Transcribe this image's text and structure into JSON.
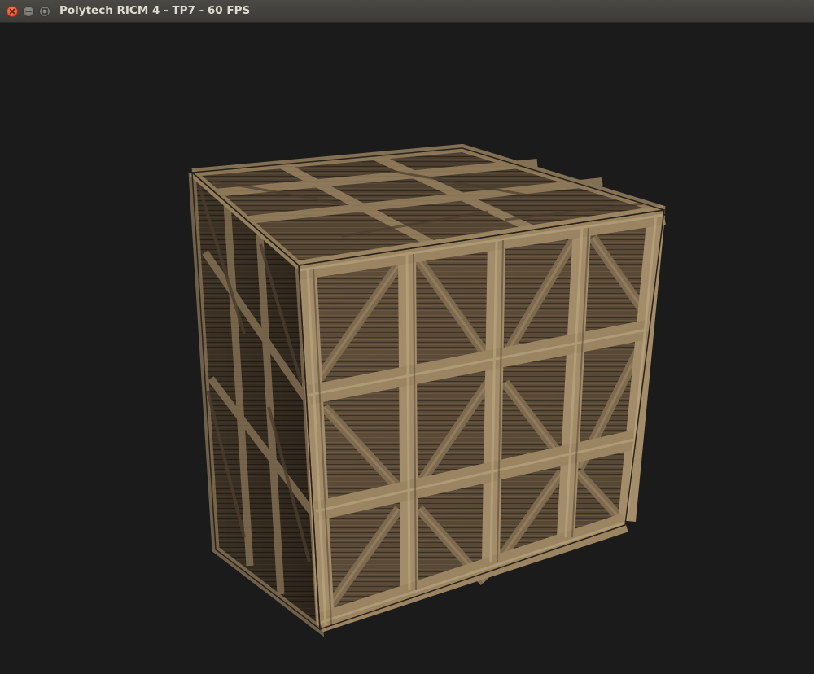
{
  "window": {
    "title": "Polytech RICM 4 - TP7 - 60 FPS",
    "close_icon": "close-icon",
    "minimize_icon": "minimize-icon",
    "maximize_icon": "maximize-icon"
  },
  "scene": {
    "background_color": "#1b1b1b",
    "object": "wooden crate cube",
    "wood_colors": {
      "light": "#a08a68",
      "mid": "#6f5c43",
      "dark": "#3a3024"
    }
  }
}
